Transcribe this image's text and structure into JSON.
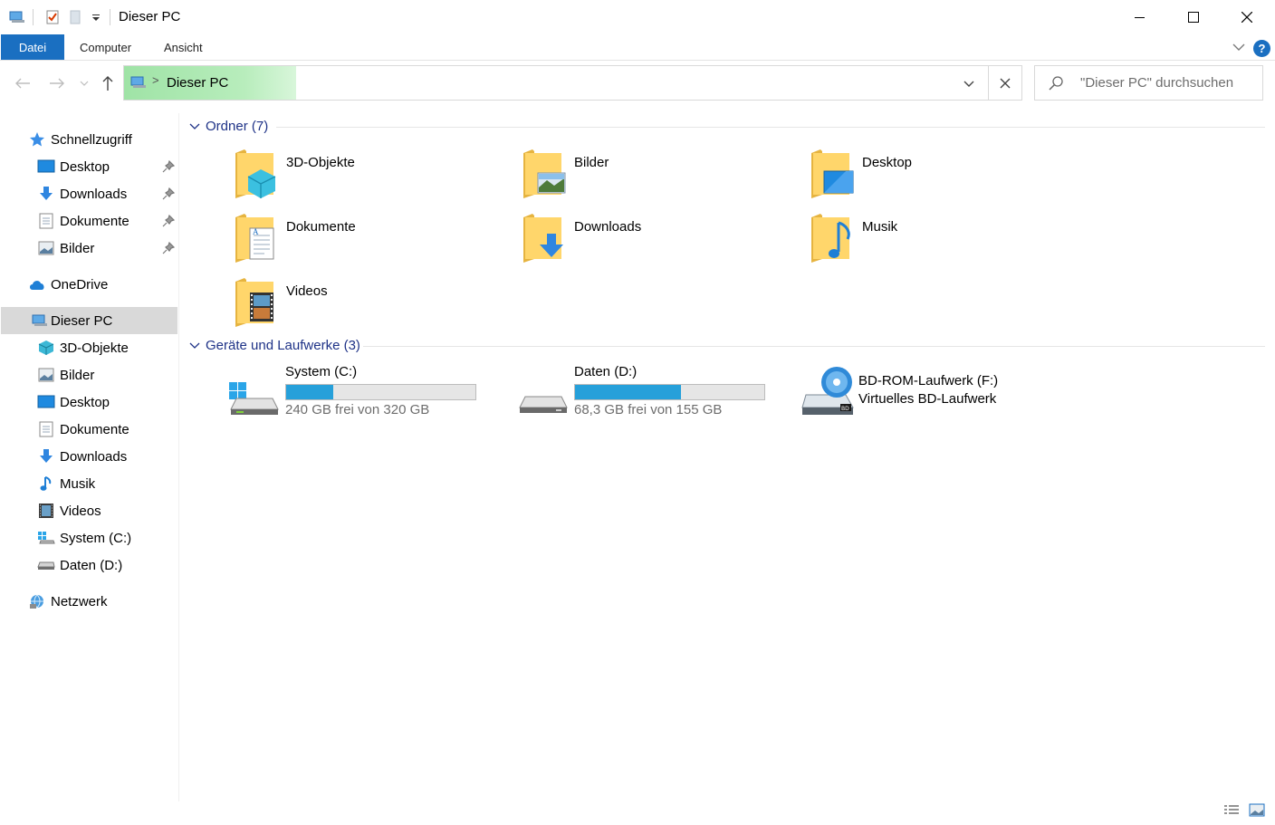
{
  "window": {
    "title": "Dieser PC",
    "accent": "#1a6fc1"
  },
  "ribbon": {
    "tabs": [
      "Datei",
      "Computer",
      "Ansicht"
    ],
    "help_label": "?"
  },
  "address": {
    "location": "Dieser PC",
    "separator": ">",
    "search_placeholder": "\"Dieser PC\" durchsuchen"
  },
  "nav": {
    "items": [
      {
        "label": "Schnellzugriff",
        "icon": "star-icon",
        "pinned": false
      },
      {
        "label": "Desktop",
        "icon": "desktop-icon",
        "pinned": true
      },
      {
        "label": "Downloads",
        "icon": "download-icon",
        "pinned": true
      },
      {
        "label": "Dokumente",
        "icon": "document-icon",
        "pinned": true
      },
      {
        "label": "Bilder",
        "icon": "picture-icon",
        "pinned": true
      },
      {
        "label": "OneDrive",
        "icon": "cloud-icon",
        "pinned": false
      },
      {
        "label": "Dieser PC",
        "icon": "computer-icon",
        "selected": true
      },
      {
        "label": "3D-Objekte",
        "icon": "cube-icon"
      },
      {
        "label": "Bilder",
        "icon": "picture-icon"
      },
      {
        "label": "Desktop",
        "icon": "desktop-icon"
      },
      {
        "label": "Dokumente",
        "icon": "document-icon"
      },
      {
        "label": "Downloads",
        "icon": "download-icon"
      },
      {
        "label": "Musik",
        "icon": "music-note-icon"
      },
      {
        "label": "Videos",
        "icon": "film-icon"
      },
      {
        "label": "System (C:)",
        "icon": "windows-drive-icon"
      },
      {
        "label": "Daten (D:)",
        "icon": "drive-icon"
      },
      {
        "label": "Netzwerk",
        "icon": "network-icon"
      }
    ]
  },
  "content": {
    "folders_header": "Ordner (7)",
    "folders": [
      {
        "label": "3D-Objekte",
        "icon": "cube-folder-icon"
      },
      {
        "label": "Bilder",
        "icon": "pictures-folder-icon"
      },
      {
        "label": "Desktop",
        "icon": "desktop-folder-icon"
      },
      {
        "label": "Dokumente",
        "icon": "documents-folder-icon"
      },
      {
        "label": "Downloads",
        "icon": "downloads-folder-icon"
      },
      {
        "label": "Musik",
        "icon": "music-folder-icon"
      },
      {
        "label": "Videos",
        "icon": "videos-folder-icon"
      }
    ],
    "drives_header": "Geräte und Laufwerke (3)",
    "drives": [
      {
        "name": "System (C:)",
        "free_text": "240 GB frei von 320 GB",
        "used_fraction": 0.25,
        "icon": "windows-drive-icon"
      },
      {
        "name": "Daten (D:)",
        "free_text": "68,3 GB frei von 155 GB",
        "used_fraction": 0.56,
        "icon": "drive-icon"
      },
      {
        "name": "BD-ROM-Laufwerk (F:)",
        "subtitle": "Virtuelles BD-Laufwerk",
        "icon": "bd-rom-drive-icon"
      }
    ],
    "drive_bar_color": "#26a0da"
  }
}
